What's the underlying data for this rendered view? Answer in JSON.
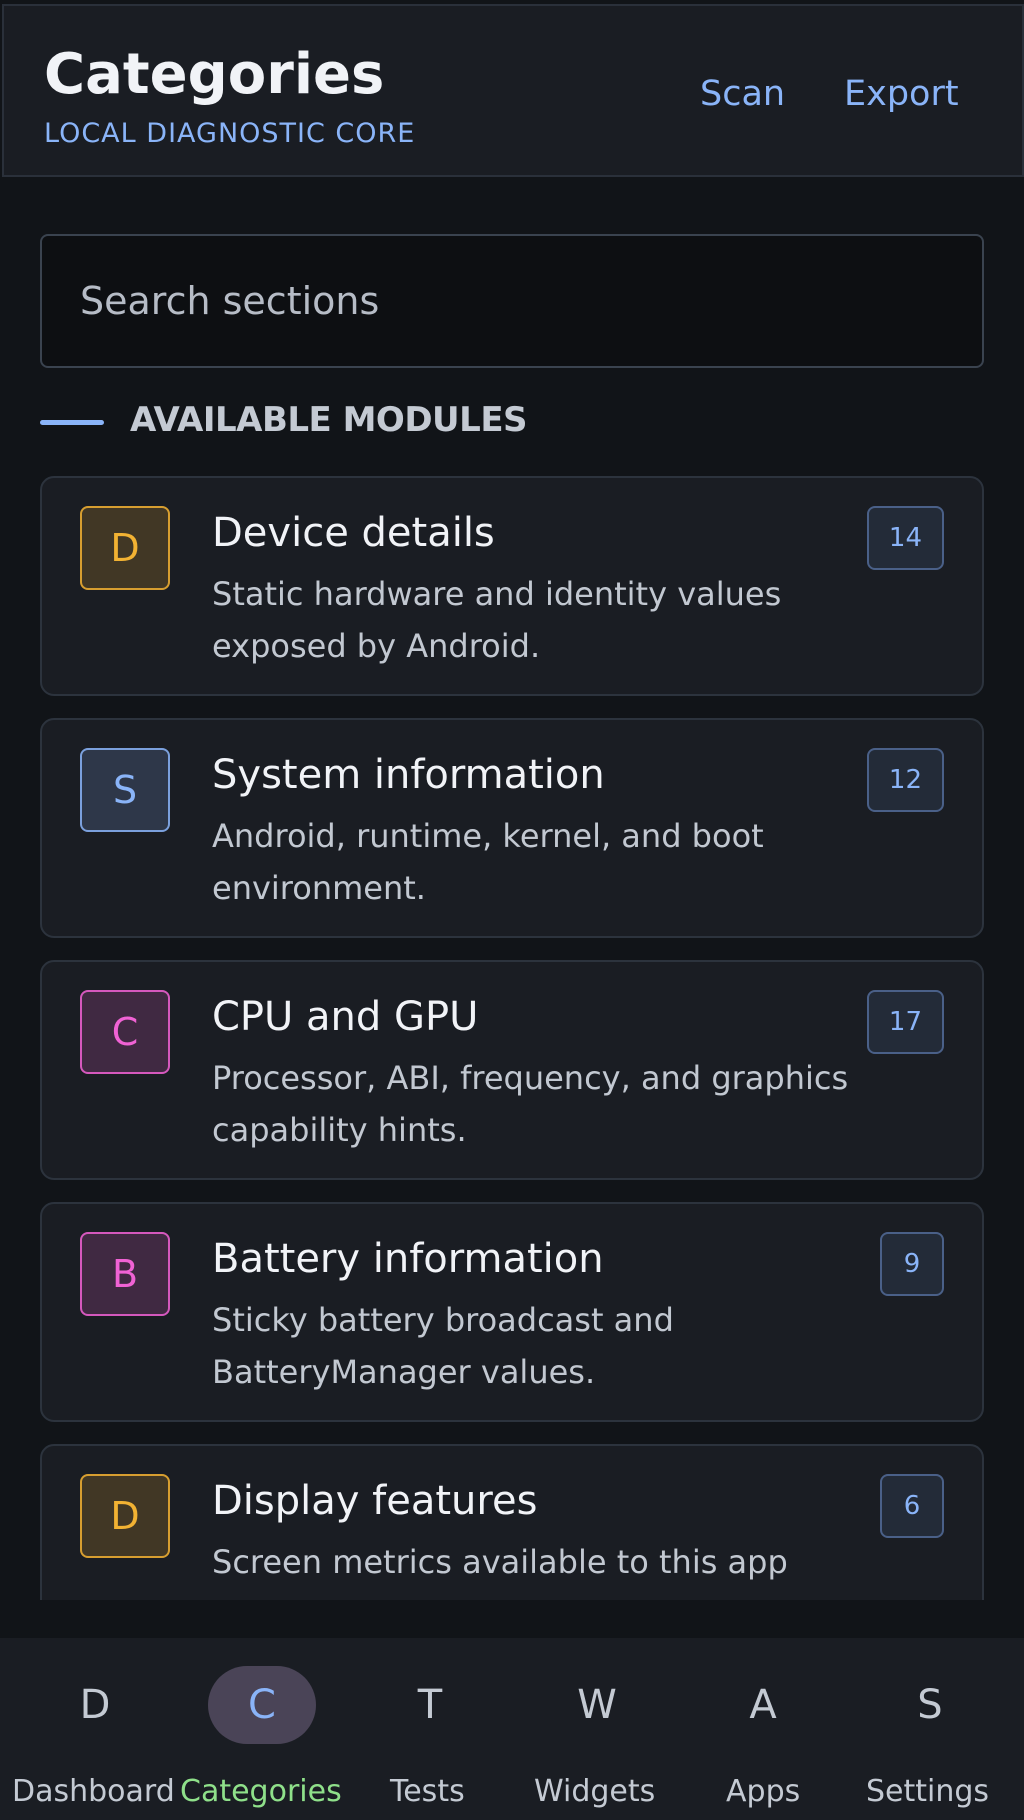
{
  "header": {
    "title": "Categories",
    "subtitle": "LOCAL DIAGNOSTIC CORE",
    "actions": {
      "scan": "Scan",
      "export": "Export"
    }
  },
  "search": {
    "placeholder": "Search sections",
    "value": ""
  },
  "section": {
    "title": "AVAILABLE MODULES",
    "accent_color": "#8ab4f8"
  },
  "categories": [
    {
      "letter": "D",
      "title": "Device details",
      "description": "Static hardware and identity values exposed by Android.",
      "count": "14",
      "color": "#f2b233"
    },
    {
      "letter": "S",
      "title": "System information",
      "description": "Android, runtime, kernel, and boot environment.",
      "count": "12",
      "color": "#8ab4f8"
    },
    {
      "letter": "C",
      "title": "CPU and GPU",
      "description": "Processor, ABI, frequency, and graphics capability hints.",
      "count": "17",
      "color": "#f062d4"
    },
    {
      "letter": "B",
      "title": "Battery information",
      "description": "Sticky battery broadcast and BatteryManager values.",
      "count": "9",
      "color": "#f062d4"
    },
    {
      "letter": "D",
      "title": "Display features",
      "description": "Screen metrics available to this app",
      "count": "6",
      "color": "#f2b233"
    }
  ],
  "bottom_nav": {
    "active_label_color": "#8fe08a",
    "items": [
      {
        "icon": "D",
        "label": "Dashboard",
        "active": false
      },
      {
        "icon": "C",
        "label": "Categories",
        "active": true
      },
      {
        "icon": "T",
        "label": "Tests",
        "active": false
      },
      {
        "icon": "W",
        "label": "Widgets",
        "active": false
      },
      {
        "icon": "A",
        "label": "Apps",
        "active": false
      },
      {
        "icon": "S",
        "label": "Settings",
        "active": false
      }
    ]
  }
}
